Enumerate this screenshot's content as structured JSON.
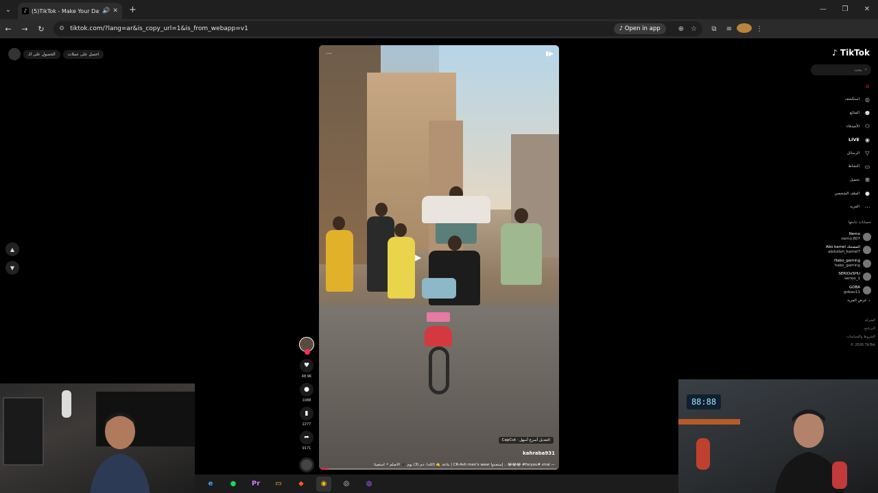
{
  "browser": {
    "tab": {
      "title": "(5)TikTok - Make Your Day",
      "favicon": "tiktok-icon"
    },
    "url": "tiktok.com/?lang=ar&is_copy_url=1&is_from_webapp=v1",
    "open_in_app": "Open in app"
  },
  "page": {
    "top_pills": [
      "احصل على عملات",
      "الحصول على الـ"
    ],
    "video": {
      "author": "kahraba931",
      "capcut_label": "CapCut · التعديل أسرع أسهل",
      "caption": "— foryou# viral# 😂😂😂 .. إستعدوا CR-Ash men's wear | بتاعة 🤙 (اللُّه) ·دم (3) يوم 🖤 الأصلم ⚡ استعينا",
      "progress": 0.04
    },
    "actions": [
      {
        "icon": "heart-icon",
        "count": "48.9K"
      },
      {
        "icon": "comment-icon",
        "count": "1088"
      },
      {
        "icon": "bookmark-icon",
        "count": "2277"
      },
      {
        "icon": "share-icon",
        "count": "9171"
      }
    ]
  },
  "sidebar": {
    "logo": "TikTok",
    "search_placeholder": "بحث",
    "menu": [
      {
        "label": "",
        "icon": "home-icon",
        "active": true
      },
      {
        "label": "استكشف",
        "icon": "compass-icon"
      },
      {
        "label": "المتابَع",
        "icon": "following-icon"
      },
      {
        "label": "الأصدقاء",
        "icon": "friends-icon"
      },
      {
        "label": "LIVE",
        "icon": "live-icon"
      },
      {
        "label": "الرسائل",
        "icon": "messages-icon"
      },
      {
        "label": "النشاط",
        "icon": "activity-icon"
      },
      {
        "label": "تحميل",
        "icon": "upload-icon"
      },
      {
        "label": "الملف الشخصي",
        "icon": "profile-icon"
      },
      {
        "label": "المزيد",
        "icon": "more-icon"
      }
    ],
    "following_heading": "حسابات تتابعها",
    "following": [
      {
        "name": "Nemo",
        "user": "nemo.807"
      },
      {
        "name": "Abo kamel المضحك",
        "user": "abdullah_kamel7"
      },
      {
        "name": "Habo_gaming",
        "user": "habo_gaming"
      },
      {
        "name": "SERIOxSHU",
        "user": "serioo_1"
      },
      {
        "name": "GOBA",
        "user": "gobav11"
      }
    ],
    "see_more": "عرض المزيد",
    "footer": [
      "الشركة",
      "البرنامج",
      "الشروط والسياسات",
      "© 2026 TikTok"
    ]
  },
  "webcam": {
    "clock": "88:88"
  },
  "taskbar": [
    "edge-icon",
    "spotify-icon",
    "premiere-icon",
    "files-icon",
    "brave-icon",
    "chrome-icon",
    "obs-icon",
    "messenger-icon"
  ],
  "colors": {
    "accent": "#fe2c55"
  }
}
